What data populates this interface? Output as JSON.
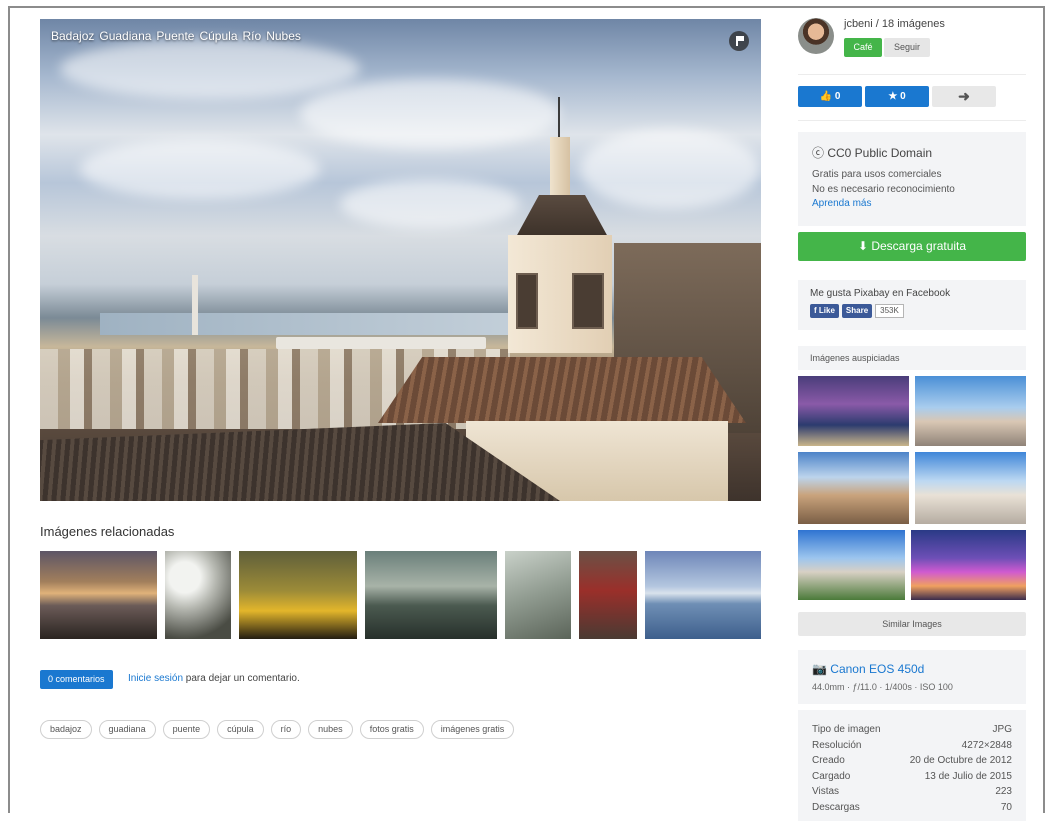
{
  "hero": {
    "tags": [
      "Badajoz",
      "Guadiana",
      "Puente",
      "Cúpula",
      "Río",
      "Nubes"
    ]
  },
  "related": {
    "title": "Imágenes relacionadas"
  },
  "comments": {
    "button_label": "0 comentarios",
    "login_link": "Inicie sesión",
    "login_suffix": " para dejar un comentario."
  },
  "tags": [
    "badajoz",
    "guadiana",
    "puente",
    "cúpula",
    "río",
    "nubes",
    "fotos gratis",
    "imágenes gratis"
  ],
  "user": {
    "name": "jcbeni / 18 imágenes",
    "cafe_label": "Café",
    "follow_label": "Seguir"
  },
  "actions": {
    "like_label": "👍 0",
    "favorite_label": "★ 0",
    "share_label": "➜"
  },
  "license": {
    "title": "ⓒ CC0 Public Domain",
    "line1": "Gratis para usos comerciales",
    "line2": "No es necesario reconocimiento",
    "link": "Aprenda más"
  },
  "download": {
    "label": "⬇ Descarga gratuita"
  },
  "facebook": {
    "title": "Me gusta Pixabay en Facebook",
    "like_label": "f Like",
    "share_label": "Share",
    "count": "353K"
  },
  "sponsored": {
    "title": "Imágenes auspiciadas"
  },
  "similar": {
    "label": "Similar Images"
  },
  "camera": {
    "name": "Canon EOS 450d",
    "specs": "44.0mm · ƒ/11.0 · 1/400s · ISO 100"
  },
  "meta": [
    {
      "label": "Tipo de imagen",
      "value": "JPG"
    },
    {
      "label": "Resolución",
      "value": "4272×2848"
    },
    {
      "label": "Creado",
      "value": "20 de Octubre de 2012"
    },
    {
      "label": "Cargado",
      "value": "13 de Julio de 2015"
    },
    {
      "label": "Vistas",
      "value": "223"
    },
    {
      "label": "Descargas",
      "value": "70"
    }
  ],
  "colors": {
    "accent_blue": "#1a78d0",
    "accent_green": "#44b549",
    "facebook_blue": "#3b5998"
  }
}
